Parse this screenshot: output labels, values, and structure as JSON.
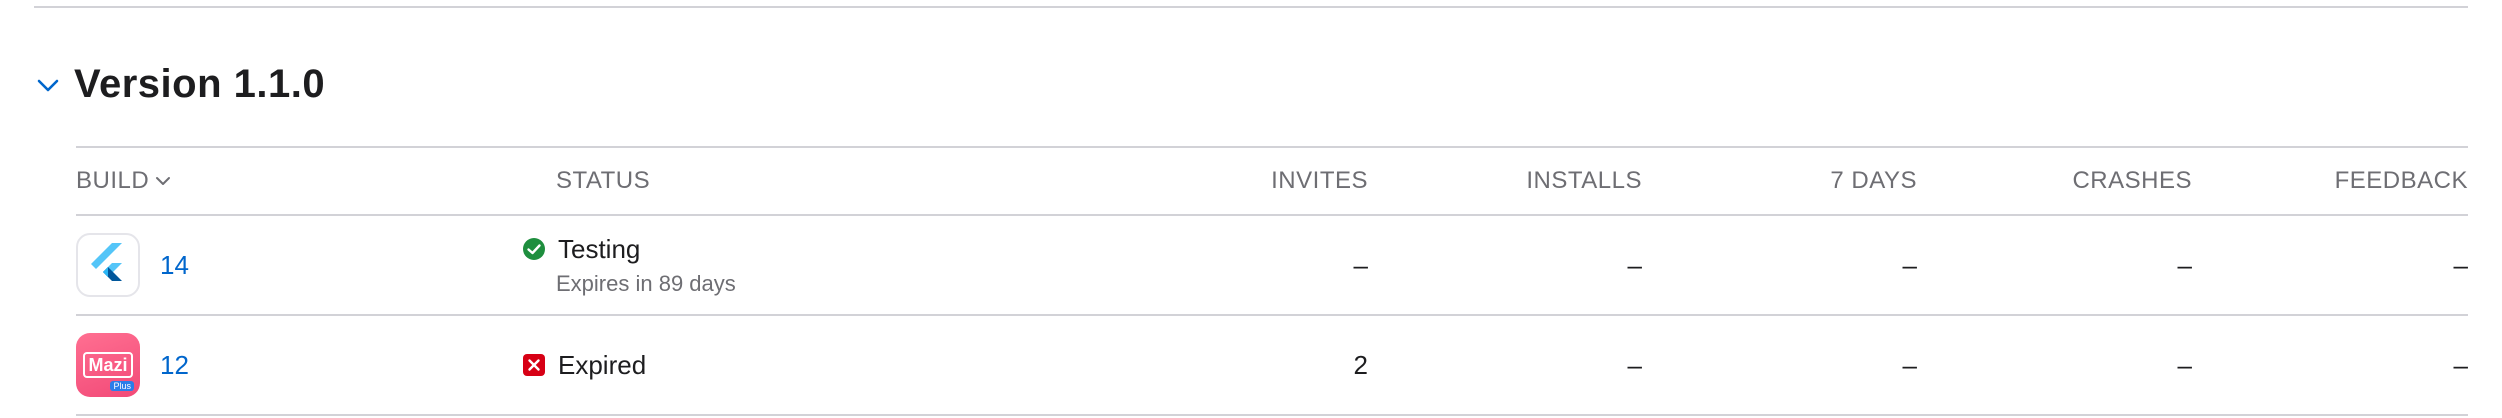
{
  "section": {
    "title": "Version 1.1.0"
  },
  "table": {
    "headers": {
      "build": "BUILD",
      "status": "STATUS",
      "invites": "INVITES",
      "installs": "INSTALLS",
      "seven_days": "7 DAYS",
      "crashes": "CRASHES",
      "feedback": "FEEDBACK"
    },
    "rows": [
      {
        "app_icon": "flutter-logo-icon",
        "build": "14",
        "status": "Testing",
        "status_icon": "check-circle-icon",
        "status_color": "#1e8e3e",
        "status_sub": "Expires in 89 days",
        "invites": "–",
        "installs": "–",
        "seven_days": "–",
        "crashes": "–",
        "feedback": "–"
      },
      {
        "app_icon": "mazi-plus-logo-icon",
        "app_icon_text": "Mazi",
        "app_icon_badge": "Plus",
        "build": "12",
        "status": "Expired",
        "status_icon": "x-square-icon",
        "status_color": "#d70015",
        "invites": "2",
        "installs": "–",
        "seven_days": "–",
        "crashes": "–",
        "feedback": "–"
      }
    ]
  },
  "colors": {
    "link": "#0066cc",
    "divider": "#d2d2d7",
    "muted": "#6e6e73"
  }
}
